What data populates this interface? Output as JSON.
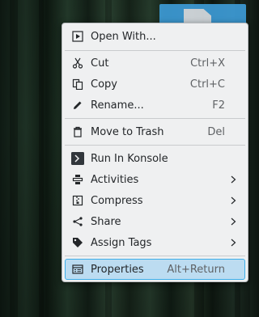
{
  "menu": {
    "items": [
      {
        "label": "Open With...",
        "shortcut": "",
        "icon": "open-with-icon",
        "submenu": false
      },
      {
        "label": "Cut",
        "shortcut": "Ctrl+X",
        "icon": "scissors-icon",
        "submenu": false
      },
      {
        "label": "Copy",
        "shortcut": "Ctrl+C",
        "icon": "copy-icon",
        "submenu": false
      },
      {
        "label": "Rename...",
        "shortcut": "F2",
        "icon": "pencil-icon",
        "submenu": false
      },
      {
        "label": "Move to Trash",
        "shortcut": "Del",
        "icon": "trash-icon",
        "submenu": false
      },
      {
        "label": "Run In Konsole",
        "shortcut": "",
        "icon": "terminal-icon",
        "submenu": false
      },
      {
        "label": "Activities",
        "shortcut": "",
        "icon": "activities-icon",
        "submenu": true
      },
      {
        "label": "Compress",
        "shortcut": "",
        "icon": "archive-icon",
        "submenu": true
      },
      {
        "label": "Share",
        "shortcut": "",
        "icon": "share-icon",
        "submenu": true
      },
      {
        "label": "Assign Tags",
        "shortcut": "",
        "icon": "tag-icon",
        "submenu": true
      },
      {
        "label": "Properties",
        "shortcut": "Alt+Return",
        "icon": "properties-icon",
        "submenu": false,
        "selected": true
      }
    ]
  },
  "colors": {
    "menu_bg": "#eff0f1",
    "selection_bg": "#bcdcf1",
    "selection_border": "#3daee9",
    "text": "#232629"
  }
}
